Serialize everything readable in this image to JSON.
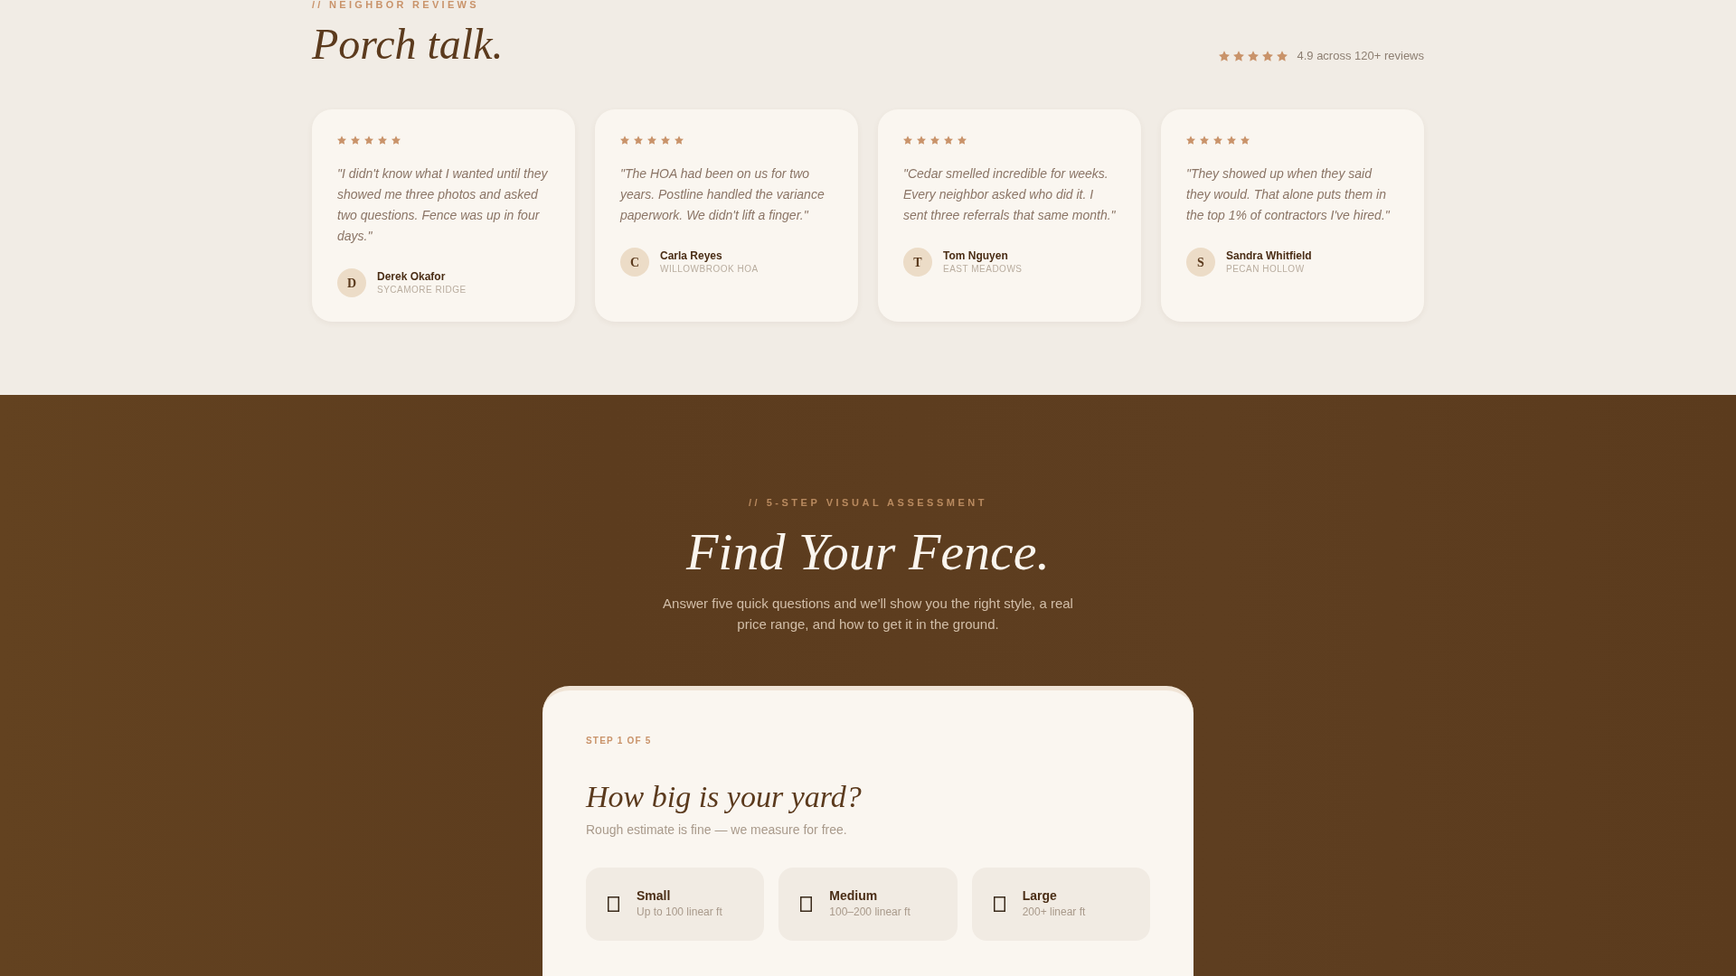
{
  "reviews_section": {
    "eyebrow": "// NEIGHBOR REVIEWS",
    "title": "Porch talk.",
    "rating": {
      "stars": 5,
      "text": "4.9 across 120+ reviews"
    },
    "reviews": [
      {
        "stars": 5,
        "quote": "\"I didn't know what I wanted until they showed me three photos and asked two questions. Fence was up in four days.\"",
        "initial": "D",
        "name": "Derek Okafor",
        "location": "SYCAMORE RIDGE"
      },
      {
        "stars": 5,
        "quote": "\"The HOA had been on us for two years. Postline handled the variance paperwork. We didn't lift a finger.\"",
        "initial": "C",
        "name": "Carla Reyes",
        "location": "WILLOWBROOK HOA"
      },
      {
        "stars": 5,
        "quote": "\"Cedar smelled incredible for weeks. Every neighbor asked who did it. I sent three referrals that same month.\"",
        "initial": "T",
        "name": "Tom Nguyen",
        "location": "EAST MEADOWS"
      },
      {
        "stars": 5,
        "quote": "\"They showed up when they said they would. That alone puts them in the top 1% of contractors I've hired.\"",
        "initial": "S",
        "name": "Sandra Whitfield",
        "location": "PECAN HOLLOW"
      }
    ]
  },
  "assessment_section": {
    "eyebrow": "// 5-STEP VISUAL ASSESSMENT",
    "title": "Find Your Fence.",
    "subtitle": "Answer five quick questions and we'll show you the right style, a real price range, and how to get it in the ground.",
    "quiz": {
      "step": "STEP 1 OF 5",
      "question": "How big is your yard?",
      "hint": "Rough estimate is fine — we measure for free.",
      "options": [
        {
          "label": "Small",
          "detail": "Up to 100 linear ft",
          "selected": false
        },
        {
          "label": "Medium",
          "detail": "100–200 linear ft",
          "selected": false
        },
        {
          "label": "Large",
          "detail": "200+ linear ft",
          "selected": false
        }
      ]
    }
  }
}
